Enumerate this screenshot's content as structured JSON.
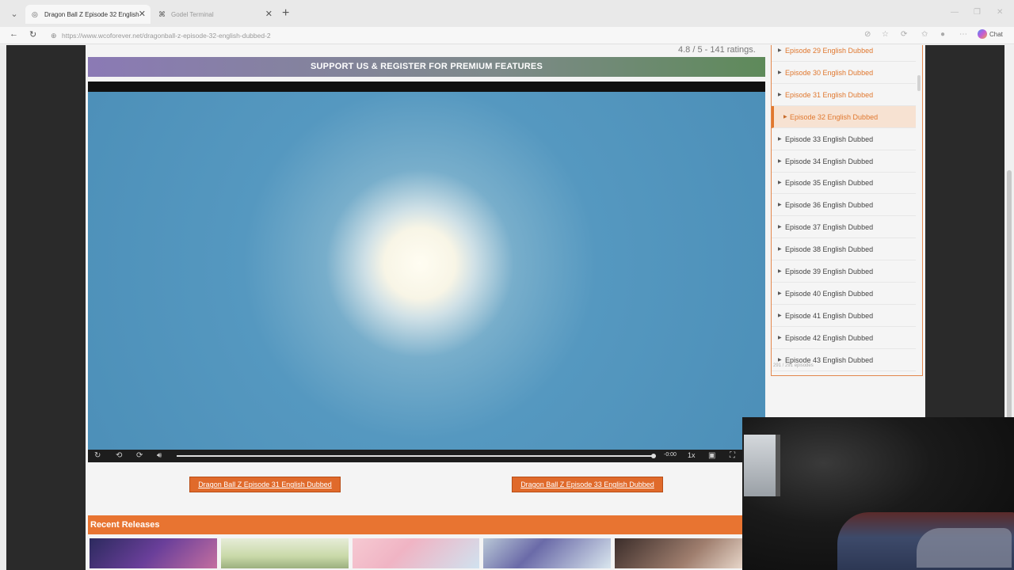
{
  "browser": {
    "tabs": [
      {
        "title": "Dragon Ball Z Episode 32 English",
        "active": true
      },
      {
        "title": "Godel Terminal",
        "active": false
      }
    ],
    "url": "https://www.wcoforever.net/dragonball-z-episode-32-english-dubbed-2",
    "chat_label": "Chat"
  },
  "page": {
    "rating": "4.8 / 5 - 141 ratings.",
    "support_banner": "SUPPORT US & REGISTER FOR PREMIUM FEATURES",
    "player": {
      "time_remaining": "-0:00",
      "speed": "1x",
      "progress": 1.0
    },
    "prev_episode": "Dragon Ball Z Episode 31 English Dubbed",
    "next_episode": "Dragon Ball Z Episode 33 English Dubbed",
    "recent_releases_title": "Recent Releases",
    "episode_list": {
      "items": [
        {
          "label": "Episode 29 English Dubbed",
          "state": "visited"
        },
        {
          "label": "Episode 30 English Dubbed",
          "state": "visited"
        },
        {
          "label": "Episode 31 English Dubbed",
          "state": "visited"
        },
        {
          "label": "Episode 32 English Dubbed",
          "state": "current"
        },
        {
          "label": "Episode 33 English Dubbed",
          "state": "normal"
        },
        {
          "label": "Episode 34 English Dubbed",
          "state": "normal"
        },
        {
          "label": "Episode 35 English Dubbed",
          "state": "normal"
        },
        {
          "label": "Episode 36 English Dubbed",
          "state": "normal"
        },
        {
          "label": "Episode 37 English Dubbed",
          "state": "normal"
        },
        {
          "label": "Episode 38 English Dubbed",
          "state": "normal"
        },
        {
          "label": "Episode 39 English Dubbed",
          "state": "normal"
        },
        {
          "label": "Episode 40 English Dubbed",
          "state": "normal"
        },
        {
          "label": "Episode 41 English Dubbed",
          "state": "normal"
        },
        {
          "label": "Episode 42 English Dubbed",
          "state": "normal"
        },
        {
          "label": "Episode 43 English Dubbed",
          "state": "normal"
        }
      ],
      "count": "291 / 291 episodes"
    }
  },
  "colors": {
    "accent_orange": "#e06a2b",
    "visited_link": "#e0782f"
  }
}
